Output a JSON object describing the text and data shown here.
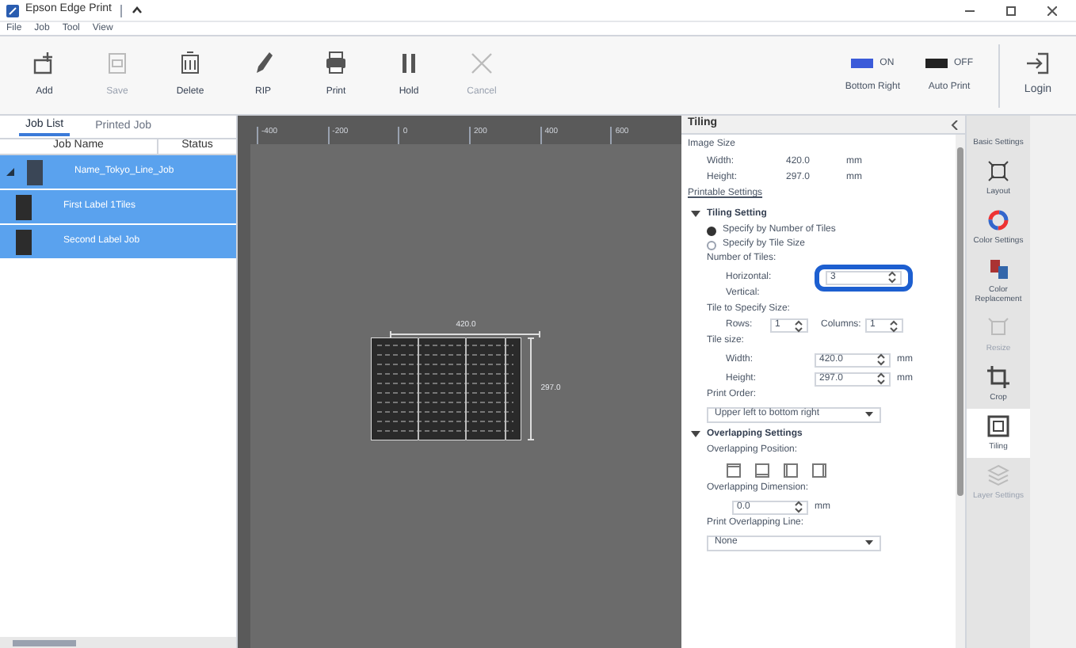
{
  "window": {
    "title": "Epson Edge Print"
  },
  "menu": [
    "File",
    "Job",
    "Tool",
    "View"
  ],
  "toolbar": [
    {
      "label": "Add",
      "disabled": false
    },
    {
      "label": "Save",
      "disabled": true
    },
    {
      "label": "Delete",
      "disabled": false
    },
    {
      "label": "RIP",
      "disabled": false
    },
    {
      "label": "Print",
      "disabled": false
    },
    {
      "label": "Hold",
      "disabled": false
    },
    {
      "label": "Cancel",
      "disabled": true
    }
  ],
  "toggles": [
    {
      "state": "ON",
      "label": "Bottom Right",
      "on": true
    },
    {
      "state": "OFF",
      "label": "Auto Print",
      "on": false
    }
  ],
  "login": "Login",
  "job_panel": {
    "tabs": [
      {
        "label": "Job List",
        "selected": true
      },
      {
        "label": "Printed Job",
        "selected": false
      }
    ],
    "columns": [
      "Job Name",
      "Status"
    ],
    "rows": [
      {
        "name": "Name_Tokyo_Line_Job",
        "selected": true,
        "children": [
          {
            "name": "First Label 1Tiles",
            "selected": true
          },
          {
            "name": "Second Label Job",
            "selected": true
          }
        ]
      }
    ]
  },
  "canvas": {
    "ruler": [
      "-400",
      "-200",
      "0",
      "200",
      "400",
      "600"
    ],
    "width_label": "420.0",
    "height_label": "297.0"
  },
  "settings": {
    "title": "Tiling",
    "rows": [
      {
        "kind": "heading",
        "text": "Image Size"
      },
      {
        "kind": "pair",
        "label": "Width:",
        "value": "420.0",
        "unit": "mm"
      },
      {
        "kind": "pair",
        "label": "Height:",
        "value": "297.0",
        "unit": "mm"
      },
      {
        "kind": "link",
        "text": "Printable Settings"
      },
      {
        "kind": "section",
        "text": "Tiling Setting",
        "expanded": true
      },
      {
        "kind": "radio",
        "text": "Specify by Number of Tiles",
        "selected": true
      },
      {
        "kind": "radio",
        "text": "Specify by Tile Size",
        "selected": false
      },
      {
        "kind": "label",
        "text": "Number of Tiles:"
      },
      {
        "kind": "field",
        "label": "Horizontal:",
        "value": "3",
        "highlighted": true
      },
      {
        "kind": "sublabel",
        "text": "Vertical:"
      },
      {
        "kind": "double",
        "label": "Tile to Specify Size:",
        "a_label": "Rows:",
        "a_value": "1",
        "b_label": "Columns:",
        "b_value": "1"
      },
      {
        "kind": "label",
        "text": "Tile size:"
      },
      {
        "kind": "field",
        "label": "Width:",
        "value": "420.0",
        "unit": "mm",
        "highlighted": false
      },
      {
        "kind": "field",
        "label": "Height:",
        "value": "297.0",
        "unit": "mm",
        "highlighted": false
      },
      {
        "kind": "label",
        "text": "Print Order:"
      },
      {
        "kind": "dropdown",
        "value": "Upper left to bottom right"
      },
      {
        "kind": "section",
        "text": "Overlapping Settings",
        "expanded": true
      },
      {
        "kind": "label",
        "text": "Overlapping Position:"
      },
      {
        "kind": "icons"
      },
      {
        "kind": "label",
        "text": "Overlapping Dimension:"
      },
      {
        "kind": "field",
        "label": "",
        "value": "0.0",
        "unit": "mm",
        "highlighted": false
      },
      {
        "kind": "label",
        "text": "Print Overlapping Line:"
      },
      {
        "kind": "dropdown",
        "value": "None"
      }
    ]
  },
  "side_tabs": [
    {
      "label": "Basic Settings",
      "selected": false,
      "disabled": false
    },
    {
      "label": "Layout",
      "selected": false,
      "disabled": false
    },
    {
      "label": "Color Settings",
      "selected": false,
      "disabled": false
    },
    {
      "label": "Color Replacement",
      "selected": false,
      "disabled": false
    },
    {
      "label": "Resize",
      "selected": false,
      "disabled": true
    },
    {
      "label": "Crop",
      "selected": false,
      "disabled": false
    },
    {
      "label": "Tiling",
      "selected": true,
      "disabled": false
    },
    {
      "label": "Layer Settings",
      "selected": false,
      "disabled": true
    }
  ]
}
